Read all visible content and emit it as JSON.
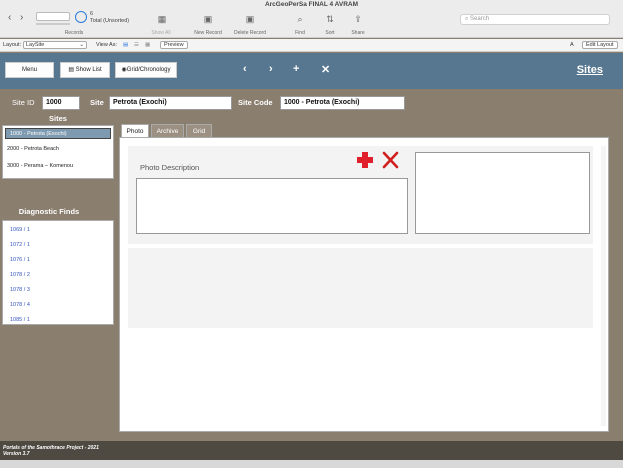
{
  "window": {
    "title": "ArcGeoPerSa FINAL 4 AVRAM"
  },
  "toolbar": {
    "records_label": "Records",
    "record_value": "",
    "record_count": "6",
    "total_label": "Total (Unsorted)",
    "show_all": "Show All",
    "new_record": "New Record",
    "delete_record": "Delete Record",
    "find": "Find",
    "sort": "Sort",
    "share": "Share",
    "search_placeholder": "Search"
  },
  "layoutbar": {
    "layout_label": "Layout:",
    "layout_value": "LaySite",
    "view_as_label": "View As:",
    "preview": "Preview",
    "edit_layout": "Edit Layout"
  },
  "header": {
    "menu_button": "Menu",
    "show_list_button": "Show List",
    "grid_button": "Grid/Chronology",
    "prev": "‹",
    "next": "›",
    "add": "+",
    "close": "✕",
    "title": "Sites"
  },
  "site": {
    "id_label": "Site ID",
    "id_value": "1000",
    "site_label": "Site",
    "site_value": "Petrota (Exochi)",
    "code_label": "Site Code",
    "code_value": "1000 - Petrota (Exochi)"
  },
  "sites_list": {
    "title": "Sites",
    "items": [
      "1000 - Petrota (Exochi)",
      "2000 - Petrota Beach",
      "3000 - Perama – Komenou"
    ]
  },
  "finds": {
    "title": "Diagnostic Finds",
    "items": [
      "1069 / 1",
      "1072 / 1",
      "1076 / 1",
      "1078 / 2",
      "1078 / 3",
      "1078 / 4",
      "1085 / 1"
    ]
  },
  "tabs": [
    "Photo",
    "Archive",
    "Grid"
  ],
  "photo": {
    "description_label": "Photo Description"
  },
  "footer": {
    "line1": "Portals of the Samothrace Project - 2021",
    "line2": "Version 3.7"
  },
  "colors": {
    "band": "#56778f",
    "background": "#8a7e6f",
    "accent_red": "#e0202a"
  }
}
